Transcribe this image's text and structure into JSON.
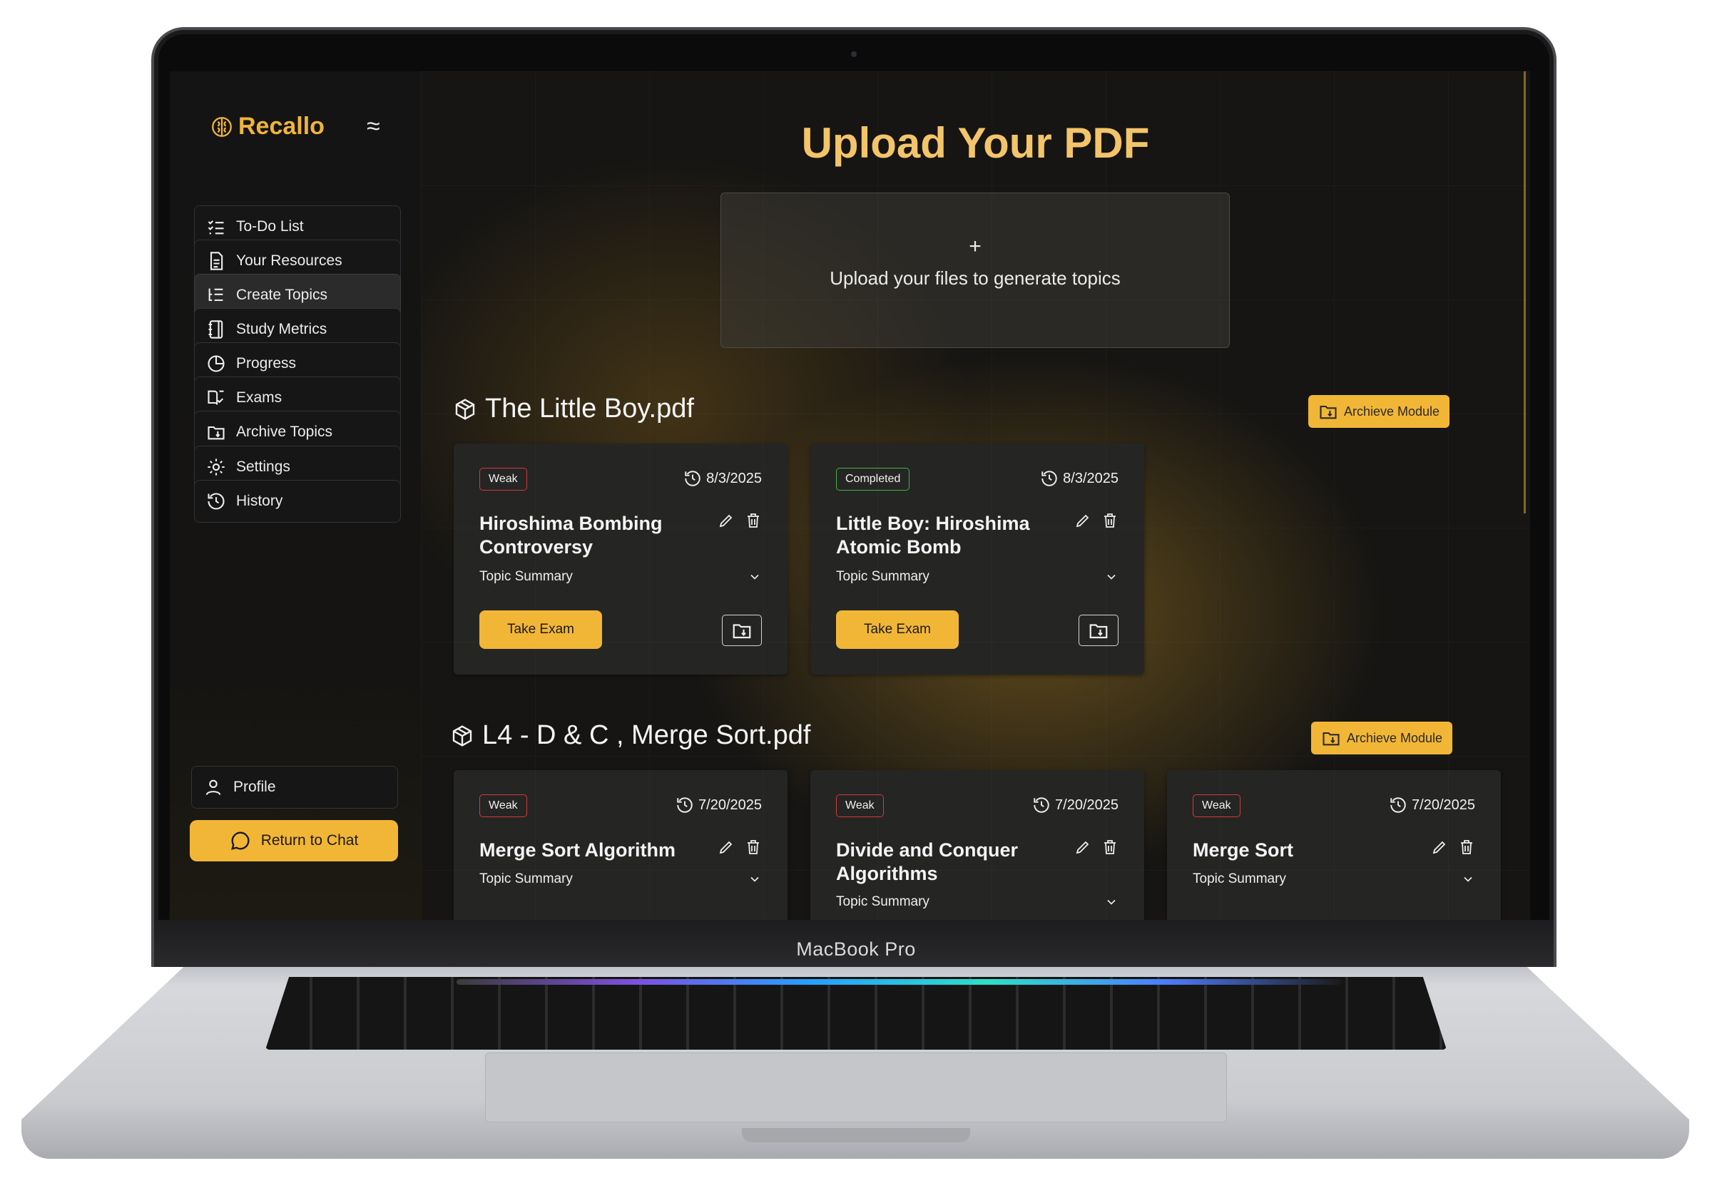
{
  "device": {
    "label": "MacBook Pro"
  },
  "brand": {
    "name": "Recallo",
    "menu_icon": "≈"
  },
  "sidebar": {
    "items": [
      {
        "label": "To-Do List",
        "icon": "checklist-icon"
      },
      {
        "label": "Your Resources",
        "icon": "document-icon"
      },
      {
        "label": "Create Topics",
        "icon": "list-tree-icon",
        "active": true
      },
      {
        "label": "Study Metrics",
        "icon": "notebook-icon"
      },
      {
        "label": "Progress",
        "icon": "pie-chart-icon"
      },
      {
        "label": "Exams",
        "icon": "book-check-icon"
      },
      {
        "label": "Archive Topics",
        "icon": "folder-archive-icon"
      },
      {
        "label": "Settings",
        "icon": "gear-icon"
      },
      {
        "label": "History",
        "icon": "history-icon"
      }
    ],
    "profile": {
      "label": "Profile",
      "icon": "user-icon"
    },
    "return_chat": {
      "label": "Return to Chat",
      "icon": "chat-bubble-icon"
    }
  },
  "main": {
    "title": "Upload Your PDF",
    "upload": {
      "plus": "+",
      "text": "Upload your files to generate topics"
    },
    "archive_module_label": "Archieve Module",
    "modules": [
      {
        "name": "The Little Boy.pdf",
        "topics": [
          {
            "status": "Weak",
            "date": "8/3/2025",
            "title": "Hiroshima Bombing Controversy",
            "summary": "Topic Summary",
            "exam": "Take Exam"
          },
          {
            "status": "Completed",
            "date": "8/3/2025",
            "title": "Little Boy: Hiroshima Atomic Bomb",
            "summary": "Topic Summary",
            "exam": "Take Exam"
          }
        ]
      },
      {
        "name": "L4 - D & C , Merge Sort.pdf",
        "topics": [
          {
            "status": "Weak",
            "date": "7/20/2025",
            "title": "Merge Sort Algorithm",
            "summary": "Topic Summary"
          },
          {
            "status": "Weak",
            "date": "7/20/2025",
            "title": "Divide and Conquer Algorithms",
            "summary": "Topic Summary"
          },
          {
            "status": "Weak",
            "date": "7/20/2025",
            "title": "Merge Sort",
            "summary": "Topic Summary"
          }
        ]
      }
    ]
  },
  "colors": {
    "accent": "#f2b636",
    "title": "#f3c46a",
    "weak": "#d43a3a",
    "completed": "#3fb34a",
    "card": "#252524"
  }
}
